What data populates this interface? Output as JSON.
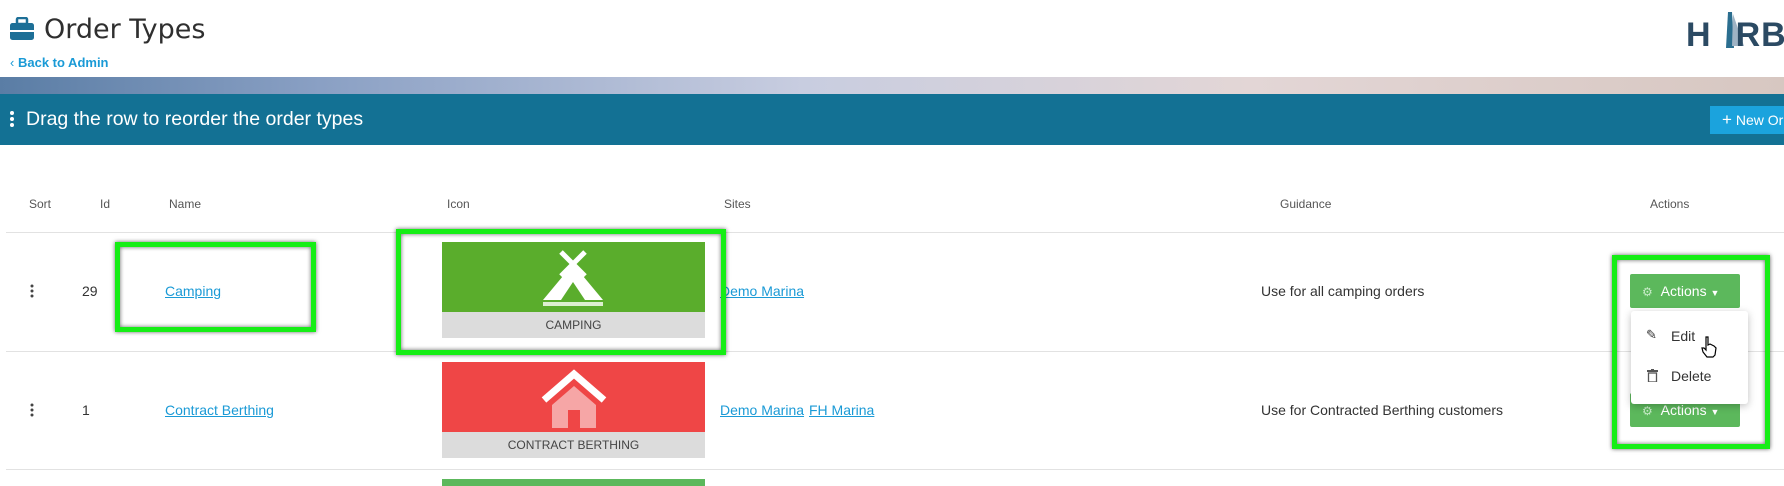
{
  "header": {
    "title": "Order Types",
    "back_label": "Back to Admin",
    "logo_text": "HARBO"
  },
  "toolbar": {
    "instruction": "Drag the row to reorder the order types",
    "new_button_label": "New Or"
  },
  "table": {
    "columns": [
      "Sort",
      "Id",
      "Name",
      "Icon",
      "Sites",
      "Guidance",
      "Actions"
    ],
    "rows": [
      {
        "id": "29",
        "name": "Camping",
        "icon_caption": "CAMPING",
        "icon_color": "#5aad2c",
        "sites": [
          "Demo Marina"
        ],
        "guidance": "Use for all camping orders",
        "actions_label": "Actions"
      },
      {
        "id": "1",
        "name": "Contract Berthing",
        "icon_caption": "CONTRACT BERTHING",
        "icon_color": "#ef4646",
        "sites": [
          "Demo Marina",
          "FH Marina"
        ],
        "guidance": "Use for Contracted Berthing customers",
        "actions_label": "Actions"
      }
    ]
  },
  "actions_menu": {
    "items": [
      "Edit",
      "Delete"
    ]
  },
  "colors": {
    "toolbar": "#137194",
    "link": "#1a9ad6",
    "action_button": "#5cb85c",
    "highlight": "#16ee16"
  }
}
